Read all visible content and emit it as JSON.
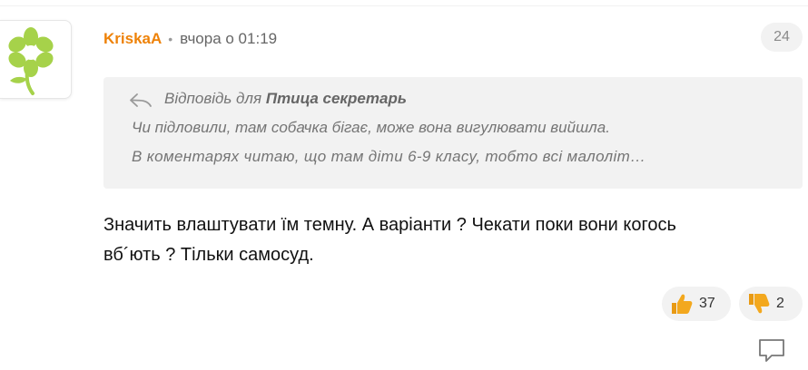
{
  "comment": {
    "author": "KriskaA",
    "separator": "•",
    "timestamp": "вчора о 01:19",
    "reply_count": "24",
    "avatar_icon": "flower-icon",
    "quote": {
      "reply_prefix": "Відповідь для",
      "reply_to": "Птица секретарь",
      "lines": [
        "Чи підловили, там собачка бігає, може вона вигулювати вийшла.",
        "В коментарях читаю, що там діти 6-9 класу, тобто всі малоліт…"
      ]
    },
    "body_lines": [
      "Значить влаштувати їм темну. А варіанти ? Чекати поки вони когось",
      "вб´ють ? Тільки самосуд."
    ],
    "likes": "37",
    "dislikes": "2"
  },
  "colors": {
    "author": "#ee8208",
    "avatar_flower": "#a6d24a",
    "quote_bg": "#f2f2f2",
    "thumb": "#f3a81e"
  }
}
